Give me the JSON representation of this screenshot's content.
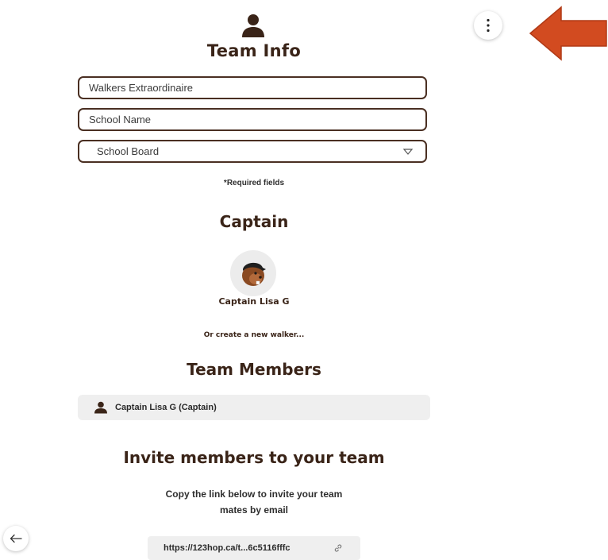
{
  "header": {
    "title": "Team Info",
    "icon": "person-icon"
  },
  "menu": {
    "icon": "kebab-menu-icon"
  },
  "annotation": {
    "icon": "arrow-left-annotation",
    "color": "#d24b20"
  },
  "form": {
    "team_name_value": "Walkers Extraordinaire",
    "school_name_placeholder": "School Name",
    "school_board_selected": "School Board",
    "required_note": "*Required fields"
  },
  "captain": {
    "heading": "Captain",
    "name": "Captain Lisa G",
    "create_new_link": "Or create a new walker..."
  },
  "team_members": {
    "heading": "Team Members",
    "items": [
      {
        "label": "Captain Lisa G (Captain)",
        "icon": "person-icon"
      }
    ]
  },
  "invite": {
    "heading": "Invite members to your team",
    "line1": "Copy the link below to invite your team",
    "line2": "mates by email",
    "link_text": "https://123hop.ca/t...6c5116fffc",
    "link_icon": "link-icon"
  },
  "navigation": {
    "back_icon": "back-arrow-icon"
  },
  "colors": {
    "primary_text": "#3a2418",
    "border": "#4a2f22",
    "panel_bg": "#efefef"
  }
}
